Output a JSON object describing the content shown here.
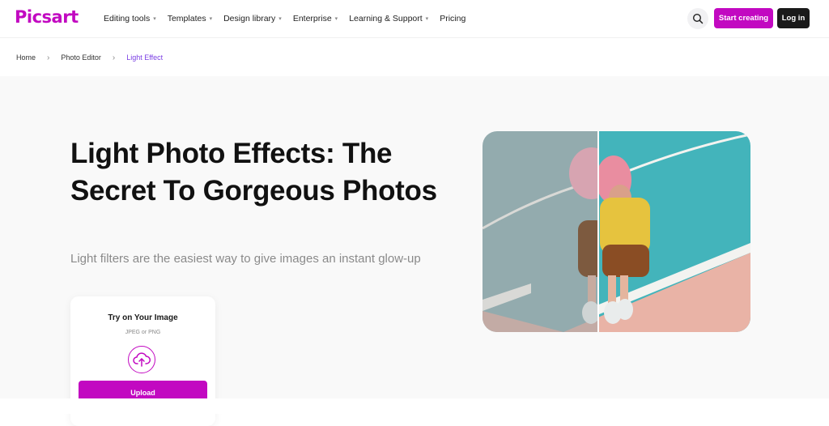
{
  "header": {
    "logo": "Picsart",
    "nav": [
      {
        "label": "Editing tools",
        "dropdown": true
      },
      {
        "label": "Templates",
        "dropdown": true
      },
      {
        "label": "Design library",
        "dropdown": true
      },
      {
        "label": "Enterprise",
        "dropdown": true
      },
      {
        "label": "Learning & Support",
        "dropdown": true
      },
      {
        "label": "Pricing",
        "dropdown": false
      }
    ],
    "search_icon": "search-icon",
    "start_label": "Start creating",
    "login_label": "Log in"
  },
  "breadcrumb": [
    "Home",
    "Photo Editor",
    "Light Effect"
  ],
  "hero": {
    "title": "Light Photo Effects: The Secret To Gorgeous Photos",
    "subtitle": "Light filters are the easiest way to give images an instant glow-up"
  },
  "upload_card": {
    "title": "Try on Your Image",
    "formats": "JPEG or PNG",
    "button_label": "Upload",
    "icon": "cloud-upload-icon"
  },
  "colors": {
    "brand": "#c209c1",
    "dark": "#1a1a1a",
    "breadcrumb_active": "#7b3fe4",
    "hero_bg": "#f9f9f9"
  }
}
